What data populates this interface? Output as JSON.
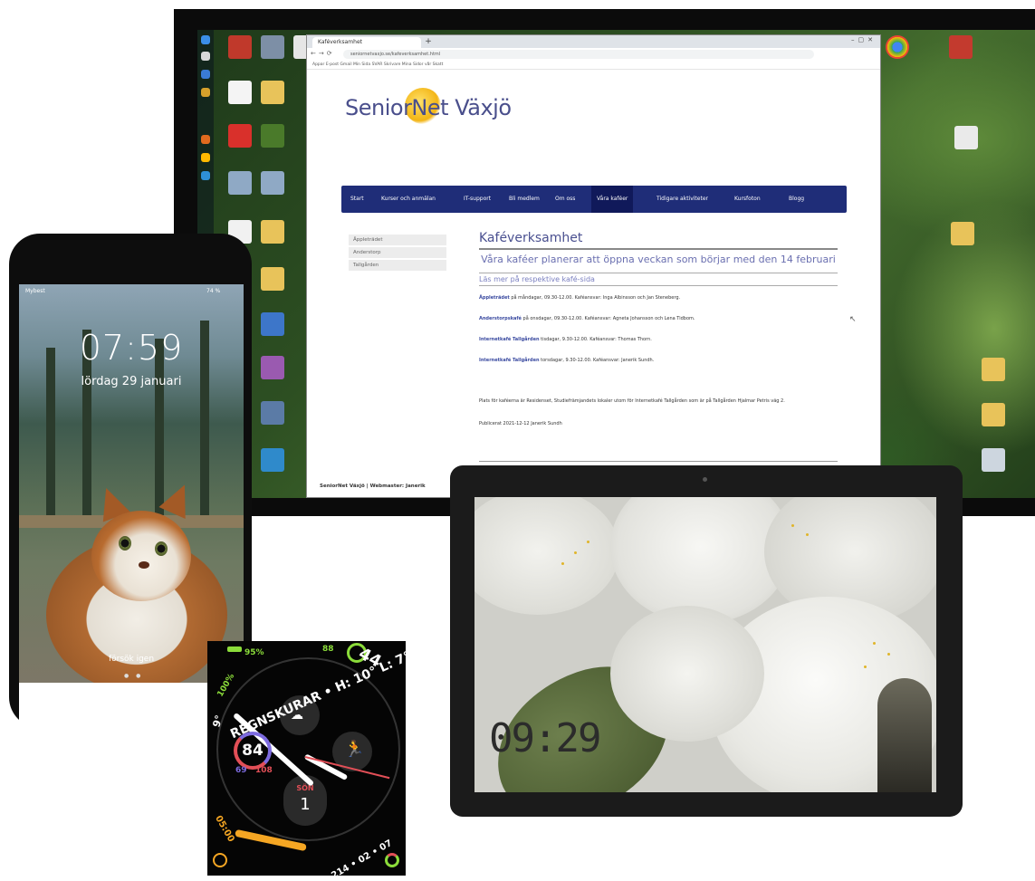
{
  "monitor": {
    "browser": {
      "tab_title": "Kaféverksamhet",
      "address": "seniornetvaxjo.se/kafeverksamhet.html",
      "bookmarks": "Appar   E-post   Gmail   Min Sida   SVAR   Skrivare   Mina Sidor   vår   Skatt",
      "logo": "SeniorNet Växjö",
      "nav": [
        "Start",
        "Kurser och anmälan",
        "IT-support",
        "Bli medlem",
        "Om oss",
        "Våra kaféer",
        "Tidigare aktiviteter",
        "Kursfoton",
        "Blogg"
      ],
      "nav_active": "Våra kaféer",
      "side_menu": [
        "Äppleträdet",
        "Anderstorp",
        "Tallgården"
      ],
      "heading": "Kaféverksamhet",
      "subheading": "Våra kaféer planerar att öppna veckan som börjar med den 14 februari",
      "section": "Läs mer på respektive kafé-sida",
      "items": [
        {
          "name": "Äppleträdet",
          "text": "på måndagar, 09.30-12.00. Kaféansvar: Inga Albinsson och Jan Steneberg."
        },
        {
          "name": "Anderstorpskafé",
          "text": "på onsdagar, 09.30-12.00. Kaféansvar: Agneta Johansson och Lena Tidbom."
        },
        {
          "name": "Internetkafé Tallgården",
          "text": "tisdagar, 9.30-12.00. Kaféansvar: Thomas Thorn."
        },
        {
          "name": "Internetkafé Tallgården",
          "text": "torsdagar, 9.30-12.00. Kaféansvar: Janerik Sundh."
        }
      ],
      "note": "Plats för kaféerna är Residenset, Studiefrämjandets lokaler utom för Internetkafé Tallgården som är på Tallgården Hjalmar Petris väg 2.",
      "published": "Publicerat 2021-12-12 Janerik Sundh",
      "footer": "SeniorNet Växjö | Webmaster: Janerik"
    }
  },
  "phone": {
    "carrier": "Mybest",
    "battery": "74 %",
    "time": "07:59",
    "date": "lördag 29 januari",
    "retry": "försök igen"
  },
  "tablet": {
    "clock": "09:29"
  },
  "watch": {
    "battery_1": "100%",
    "battery_2": "95%",
    "weather_text": "REGNSKURAR • H: 10° L: 7°",
    "air": "88",
    "top_right": "44",
    "temp_left": "9°",
    "heart": "84",
    "heart_low": "69",
    "heart_high": "108",
    "day_label": "SÖN",
    "day_number": "1",
    "time_arc": "05:00",
    "stats": "214 • 02 • 07",
    "colors": {
      "heart_ring": "#7d6be0",
      "heart_high": "#e24f57",
      "activity": "#8bdc3a",
      "timer": "#f5a623"
    }
  }
}
